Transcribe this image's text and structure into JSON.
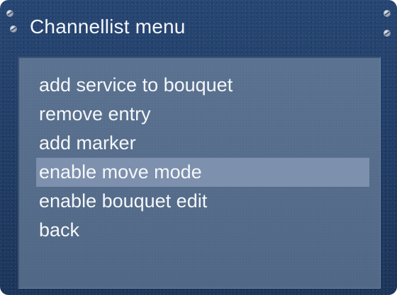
{
  "window": {
    "title": "Channellist menu"
  },
  "menu": {
    "selected_index": 3,
    "items": [
      {
        "label": "add service to bouquet"
      },
      {
        "label": "remove entry"
      },
      {
        "label": "add marker"
      },
      {
        "label": "enable move mode"
      },
      {
        "label": "enable bouquet edit"
      },
      {
        "label": "back"
      }
    ]
  },
  "colors": {
    "frame_background": "#1f3a63",
    "panel_background": "#546b89",
    "selection_highlight": "#7d90ad",
    "text": "#f5f7fa"
  }
}
